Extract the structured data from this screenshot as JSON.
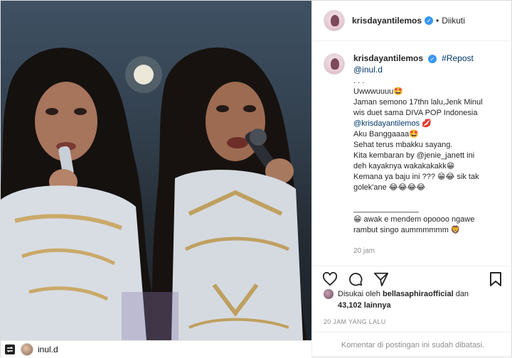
{
  "post": {
    "username": "krisdayantilemos",
    "follow_status": "Diikuti",
    "dot": "•",
    "verified_glyph": "✓",
    "repost_tag": "#Repost @inul.d",
    "caption_ellipsis": ". . .",
    "caption_lines": [
      "Uwwwuuuu🤩",
      "Jaman semono 17thn lalu,Jenk Minul",
      "wis duet sama DIVA POP Indonesia",
      "@krisdayantilemos 💋",
      "Aku Banggaaaa🤩",
      "Sehat terus mbakku sayang.",
      "Kita kembaran by @jenie_janett ini",
      "deh kayaknya wakakakakk😁",
      "Kemana ya baju ini ??? 😁😂 sik tak",
      "golek'ane 😂😂😂😂",
      "",
      "_______________",
      "😁 awak e mendem opoooo ngawe",
      "rambut singo aummmmmm 🦁"
    ],
    "caption_age": "20 jam",
    "likes_prefix": "Disukai oleh ",
    "likes_user": "bellasaphiraofficial",
    "likes_and": " dan",
    "likes_count": "43,102 lainnya",
    "posted_time": "20 JAM YANG LALU",
    "comments_disabled": "Komentar di postingan ini sudah dibatasi.",
    "repost_username": "inul.d"
  },
  "icons": {
    "like": "heart-icon",
    "comment": "comment-icon",
    "share": "share-icon",
    "save": "bookmark-icon",
    "repost": "repost-icon",
    "verified": "verified-badge-icon"
  },
  "colors": {
    "verified": "#3897f0",
    "link": "#00376b",
    "muted": "#8e8e8e",
    "text": "#262626"
  }
}
